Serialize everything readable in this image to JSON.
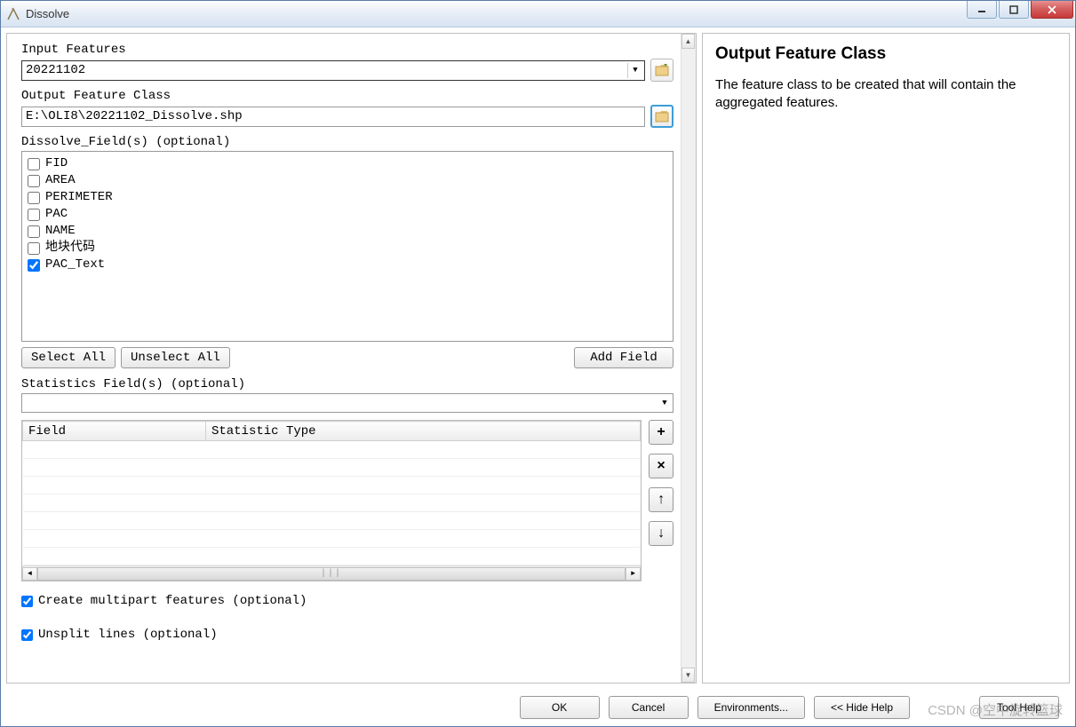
{
  "window": {
    "title": "Dissolve"
  },
  "form": {
    "input_features": {
      "label": "Input Features",
      "value": "20221102"
    },
    "output_feature_class": {
      "label": "Output Feature Class",
      "value": "E:\\OLI8\\20221102_Dissolve.shp"
    },
    "dissolve_fields": {
      "label": "Dissolve_Field(s) (optional)",
      "items": [
        {
          "name": "FID",
          "checked": false
        },
        {
          "name": "AREA",
          "checked": false
        },
        {
          "name": "PERIMETER",
          "checked": false
        },
        {
          "name": "PAC",
          "checked": false
        },
        {
          "name": "NAME",
          "checked": false
        },
        {
          "name": "地块代码",
          "checked": false
        },
        {
          "name": "PAC_Text",
          "checked": true
        }
      ]
    },
    "buttons": {
      "select_all": "Select All",
      "unselect_all": "Unselect All",
      "add_field": "Add Field"
    },
    "statistics": {
      "label": "Statistics Field(s) (optional)",
      "columns": {
        "field": "Field",
        "stat": "Statistic Type"
      }
    },
    "multipart": {
      "label": "Create multipart features (optional)",
      "checked": true
    },
    "unsplit": {
      "label": "Unsplit lines (optional)",
      "checked": true
    }
  },
  "help": {
    "title": "Output Feature Class",
    "body": "The feature class to be created that will contain the aggregated features."
  },
  "footer": {
    "ok": "OK",
    "cancel": "Cancel",
    "env": "Environments...",
    "hide": "<< Hide Help",
    "tool_help": "Tool Help"
  },
  "watermark": "CSDN @空中旋转篮球"
}
